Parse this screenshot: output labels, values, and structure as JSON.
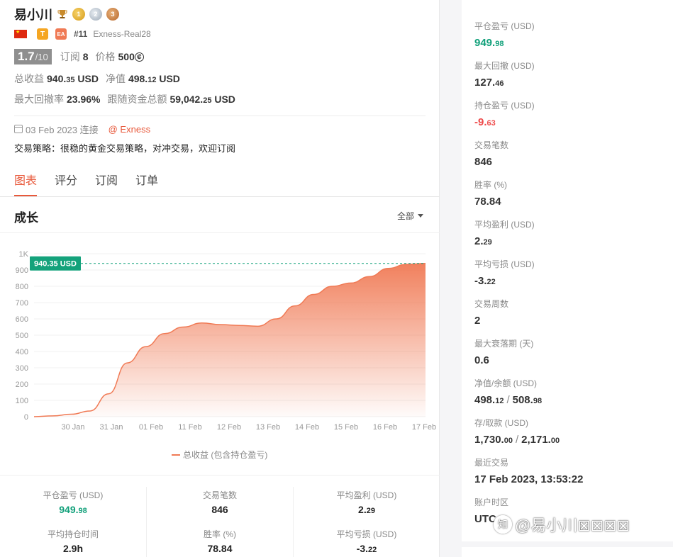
{
  "profile": {
    "name": "易小川",
    "medals": [
      "1",
      "2",
      "3"
    ],
    "rank": "#11",
    "account": "Exness-Real28",
    "tag_t": "T",
    "tag_ea": "EA",
    "rating": "1.7",
    "rating_max": "/10",
    "subscribe_label": "订阅",
    "subscribe_count": "8",
    "price_label": "价格",
    "price_value": "500",
    "price_symbol": "₡",
    "total_profit_label": "总收益",
    "total_profit_int": "940.",
    "total_profit_dec": "35",
    "total_profit_unit": " USD",
    "equity_label": "净值",
    "equity_int": "498.",
    "equity_dec": "12",
    "equity_unit": " USD",
    "drawdown_label": "最大回撤率",
    "drawdown_value": "23.96%",
    "follow_label": "跟随资金总额",
    "follow_int": "59,042.",
    "follow_dec": "25",
    "follow_unit": " USD",
    "since": "03 Feb 2023 连接",
    "broker": "@ Exness",
    "strategy": "交易策略：很稳的黄金交易策略，对冲交易，欢迎订阅"
  },
  "tabs": [
    "图表",
    "评分",
    "订阅",
    "订单"
  ],
  "section": {
    "title": "成长",
    "filter": "全部"
  },
  "chart_data": {
    "type": "area",
    "x_ticks": [
      "30 Jan",
      "31 Jan",
      "01 Feb",
      "11 Feb",
      "12 Feb",
      "13 Feb",
      "14 Feb",
      "15 Feb",
      "16 Feb",
      "17 Feb"
    ],
    "y_ticks": [
      "0",
      "100",
      "200",
      "300",
      "400",
      "500",
      "600",
      "700",
      "800",
      "900",
      "1K"
    ],
    "ylim": [
      0,
      1000
    ],
    "series": [
      {
        "name": "总收益 (包含持仓盈亏)",
        "values": [
          0,
          5,
          15,
          35,
          140,
          330,
          430,
          510,
          550,
          575,
          565,
          560,
          555,
          600,
          680,
          750,
          800,
          820,
          860,
          910,
          935,
          940
        ]
      }
    ],
    "last_value_label": "940.35 USD",
    "last_value": 940.35,
    "color": "#f07a55"
  },
  "summary": [
    [
      {
        "label": "平仓盈亏 (USD)",
        "int": "949.",
        "dec": "98",
        "tone": "green"
      },
      {
        "label": "平均持仓时间",
        "int": "2.9h",
        "dec": "",
        "tone": ""
      }
    ],
    [
      {
        "label": "交易笔数",
        "int": "846",
        "dec": "",
        "tone": ""
      },
      {
        "label": "胜率 (%)",
        "int": "78.84",
        "dec": "",
        "tone": ""
      }
    ],
    [
      {
        "label": "平均盈利 (USD)",
        "int": "2.",
        "dec": "29",
        "tone": ""
      },
      {
        "label": "平均亏损 (USD)",
        "int": "-3.",
        "dec": "22",
        "tone": ""
      }
    ]
  ],
  "right_stats": [
    {
      "label": "平仓盈亏 (USD)",
      "int": "949.",
      "dec": "98",
      "tone": "green"
    },
    {
      "label": "最大回撤 (USD)",
      "int": "127.",
      "dec": "46",
      "tone": ""
    },
    {
      "label": "持仓盈亏 (USD)",
      "int": "-9.",
      "dec": "63",
      "tone": "red"
    },
    {
      "label": "交易笔数",
      "int": "846",
      "dec": "",
      "tone": ""
    },
    {
      "label": "胜率 (%)",
      "int": "78.84",
      "dec": "",
      "tone": ""
    },
    {
      "label": "平均盈利 (USD)",
      "int": "2.",
      "dec": "29",
      "tone": ""
    },
    {
      "label": "平均亏损 (USD)",
      "int": "-3.",
      "dec": "22",
      "tone": ""
    },
    {
      "label": "交易周数",
      "int": "2",
      "dec": "",
      "tone": ""
    },
    {
      "label": "最大衰落期 (天)",
      "int": "0.6",
      "dec": "",
      "tone": ""
    },
    {
      "label": "净值/余额 (USD)",
      "int": "498.",
      "dec": "12",
      "int2": "508.",
      "dec2": "98",
      "tone": ""
    },
    {
      "label": "存/取款 (USD)",
      "int": "1,730.",
      "dec": "00",
      "int2": "2,171.",
      "dec2": "00",
      "tone": ""
    },
    {
      "label": "最近交易",
      "int": "17 Feb 2023, 13:53:22",
      "dec": "",
      "tone": ""
    },
    {
      "label": "账户时区",
      "int": "UTC",
      "dec": "",
      "tone": ""
    }
  ],
  "watermark": "@易小川⊠⊠⊠⊠",
  "watermark_logo": "知"
}
